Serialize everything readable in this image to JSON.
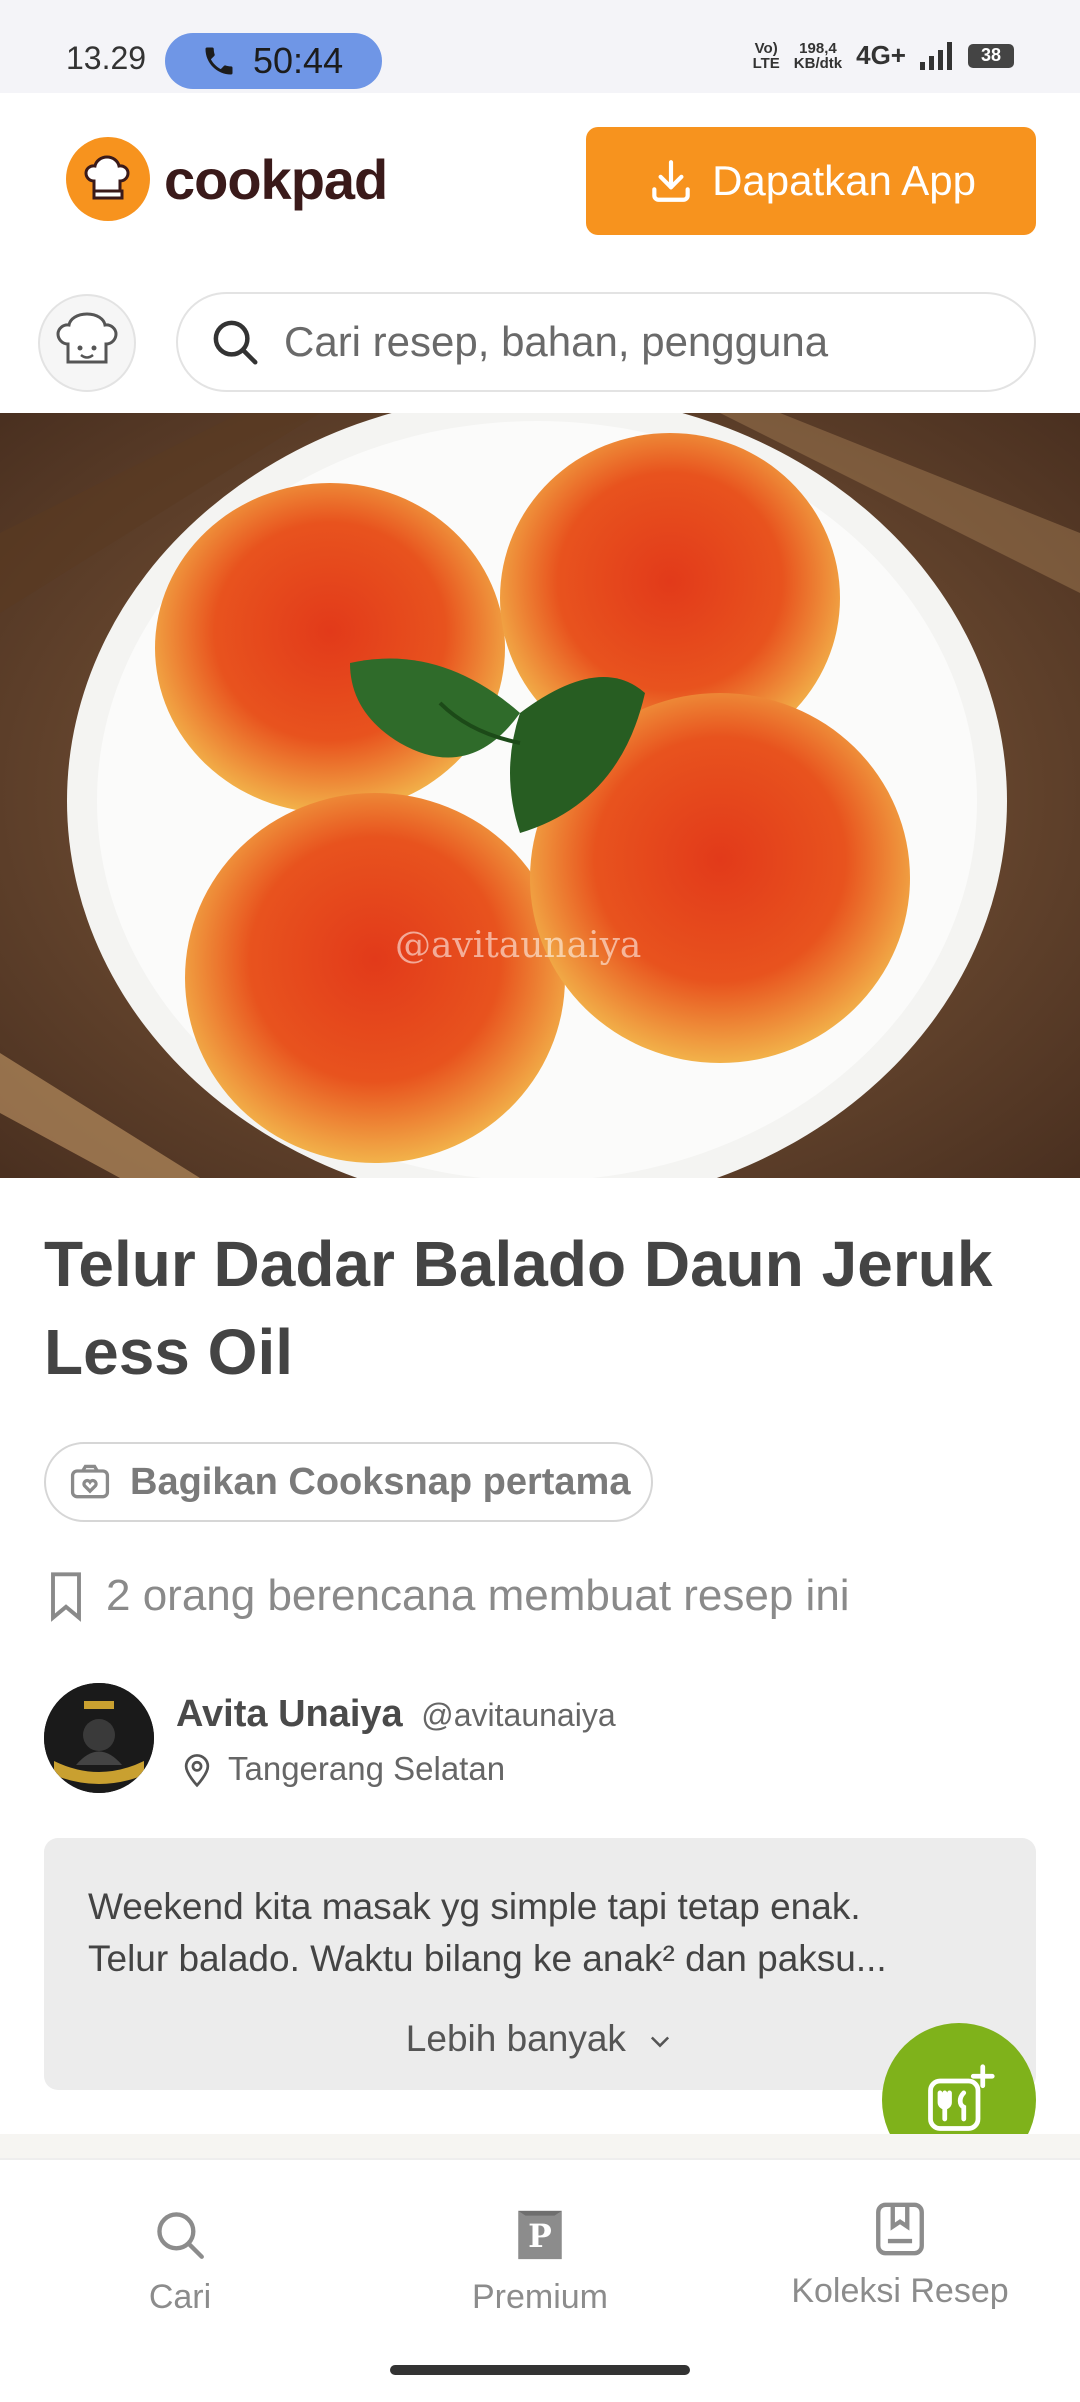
{
  "status_bar": {
    "time": "13.29",
    "call_timer": "50:44",
    "net_speed_value": "198,4",
    "net_speed_unit": "KB/dtk",
    "volte_top": "Vo)",
    "volte_bottom": "LTE",
    "network": "4G+",
    "battery": "38"
  },
  "header": {
    "logo_text": "cookpad",
    "get_app_label": "Dapatkan App"
  },
  "search": {
    "placeholder": "Cari resep, bahan, pengguna"
  },
  "hero": {
    "watermark": "@avitaunaiya"
  },
  "recipe": {
    "title": "Telur Dadar Balado Daun Jeruk Less Oil",
    "cooksnap_label": "Bagikan Cooksnap pertama",
    "plan_text": "2 orang berencana membuat resep ini"
  },
  "author": {
    "name": "Avita Unaiya",
    "handle": "@avitaunaiya",
    "location": "Tangerang Selatan"
  },
  "description": {
    "line1": "Weekend kita masak yg simple tapi tetap enak.",
    "line2": "Telur balado. Waktu bilang ke anak² dan paksu...",
    "more_label": "Lebih banyak"
  },
  "bottom_nav": {
    "items": [
      {
        "label": "Cari",
        "icon": "search-icon"
      },
      {
        "label": "Premium",
        "icon": "premium-icon"
      },
      {
        "label": "Koleksi Resep",
        "icon": "collection-icon"
      }
    ]
  },
  "colors": {
    "brand_orange": "#f7931e",
    "fab_green": "#7fb21b",
    "call_blue": "#6f96e6"
  }
}
